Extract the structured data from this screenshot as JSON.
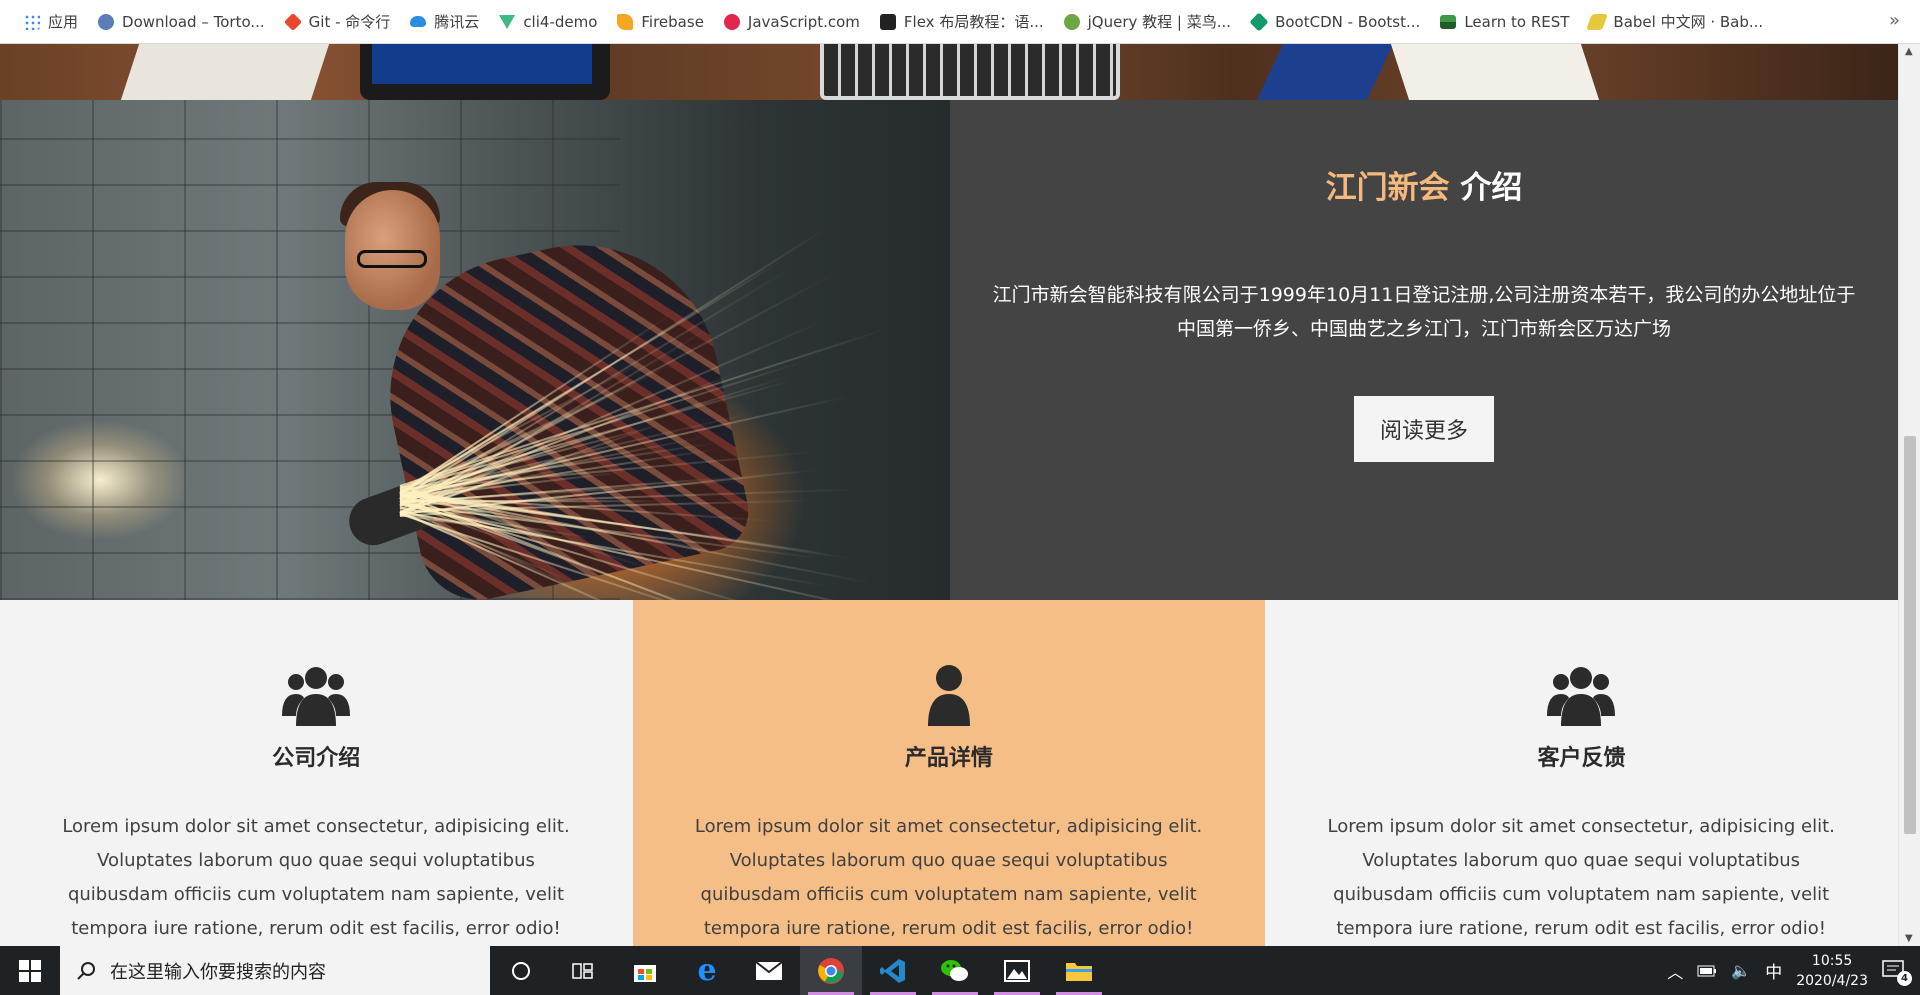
{
  "bookmarks": [
    {
      "label": "应用",
      "color": "#4285f4"
    },
    {
      "label": "Download – Torto...",
      "color": "#5b7db8"
    },
    {
      "label": "Git - 命令行",
      "color": "#e8492d"
    },
    {
      "label": "腾讯云",
      "color": "#2a8de0"
    },
    {
      "label": "cli4-demo",
      "color": "#41b883"
    },
    {
      "label": "Firebase",
      "color": "#f5a623"
    },
    {
      "label": "JavaScript.com",
      "color": "#e2264d"
    },
    {
      "label": "Flex 布局教程：语...",
      "color": "#222222"
    },
    {
      "label": "jQuery 教程 | 菜鸟...",
      "color": "#6ca743"
    },
    {
      "label": "BootCDN - Bootst...",
      "color": "#129a6a"
    },
    {
      "label": "Learn to REST",
      "color": "#3d9a46"
    },
    {
      "label": "Babel 中文网 · Bab...",
      "color": "#e6c93a"
    }
  ],
  "bookmarks_more": "»",
  "about": {
    "title_accent": "江门新会",
    "title_rest": " 介绍",
    "description": "江门市新会智能科技有限公司于1999年10月11日登记注册,公司注册资本若干，我公司的办公地址位于中国第一侨乡、中国曲艺之乡江门，江门市新会区万达广场",
    "button_label": "阅读更多"
  },
  "features": [
    {
      "icon": "users-icon",
      "title": "公司介绍",
      "text": "Lorem ipsum dolor sit amet consectetur, adipisicing elit. Voluptates laborum quo quae sequi voluptatibus quibusdam officiis cum voluptatem nam sapiente, velit tempora iure ratione, rerum odit est facilis, error odio!"
    },
    {
      "icon": "user-icon",
      "title": "产品详情",
      "text": "Lorem ipsum dolor sit amet consectetur, adipisicing elit. Voluptates laborum quo quae sequi voluptatibus quibusdam officiis cum voluptatem nam sapiente, velit tempora iure ratione, rerum odit est facilis, error odio!"
    },
    {
      "icon": "users-icon",
      "title": "客户反馈",
      "text": "Lorem ipsum dolor sit amet consectetur, adipisicing elit. Voluptates laborum quo quae sequi voluptatibus quibusdam officiis cum voluptatem nam sapiente, velit tempora iure ratione, rerum odit est facilis, error odio!"
    }
  ],
  "colors": {
    "accent": "#f5b97e",
    "highlight_bg": "#f6be87",
    "dark_bg": "#444444"
  },
  "taskbar": {
    "search_placeholder": "在这里输入你要搜索的内容",
    "ime": "中",
    "time": "10:55",
    "date": "2020/4/23",
    "notification_count": "4"
  }
}
